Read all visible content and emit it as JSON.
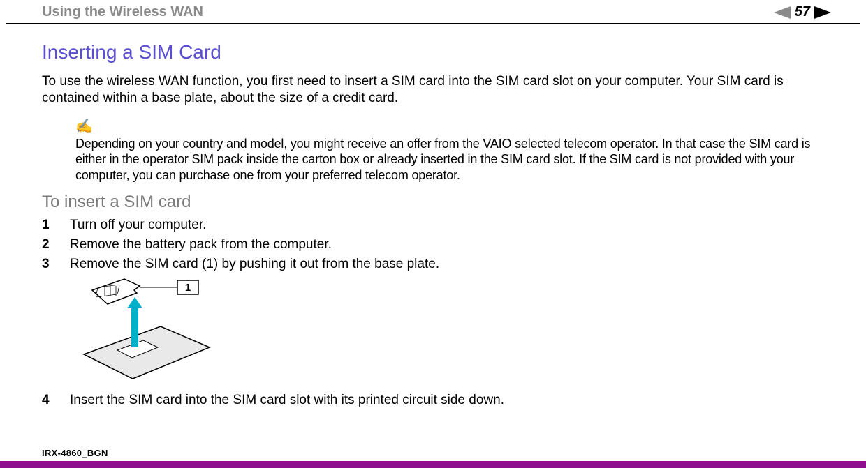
{
  "header": {
    "section_title": "Using the Wireless WAN",
    "page_number": "57"
  },
  "main": {
    "heading": "Inserting a SIM Card",
    "intro": "To use the wireless WAN function, you first need to insert a SIM card into the SIM card slot on your computer. Your SIM card is contained within a base plate, about the size of a credit card.",
    "note": "Depending on your country and model, you might receive an offer from the VAIO selected telecom operator. In that case the SIM card is either in the operator SIM pack inside the carton box or already inserted in the SIM card slot. If the SIM card is not provided with your computer, you can purchase one from your preferred telecom operator.",
    "subheading": "To insert a SIM card",
    "steps": [
      {
        "n": "1",
        "text": "Turn off your computer."
      },
      {
        "n": "2",
        "text": "Remove the battery pack from the computer."
      },
      {
        "n": "3",
        "text": "Remove the SIM card (1) by pushing it out from the base plate."
      },
      {
        "n": "4",
        "text": "Insert the SIM card into the SIM card slot with its printed circuit side down."
      }
    ],
    "figure_callout": "1"
  },
  "footer": {
    "doc_id": "IRX-4860_BGN"
  }
}
